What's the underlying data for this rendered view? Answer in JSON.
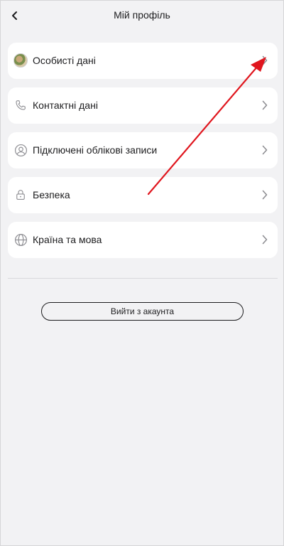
{
  "header": {
    "title": "Мій профіль",
    "back_icon": "chevron-left-icon"
  },
  "menu": {
    "items": [
      {
        "label": "Особисті дані",
        "icon": "avatar"
      },
      {
        "label": "Контактні дані",
        "icon": "phone-icon"
      },
      {
        "label": "Підключені облікові записи",
        "icon": "user-circle-icon"
      },
      {
        "label": "Безпека",
        "icon": "lock-icon"
      },
      {
        "label": "Країна та мова",
        "icon": "globe-icon"
      }
    ]
  },
  "logout": {
    "label": "Вийти з акаунта"
  },
  "annotation": {
    "color": "#e0161e",
    "icon": "red-arrow-annotation"
  },
  "colors": {
    "background": "#f2f2f4",
    "card": "#ffffff",
    "text": "#1c1c1e",
    "icon": "#8e8e93"
  }
}
